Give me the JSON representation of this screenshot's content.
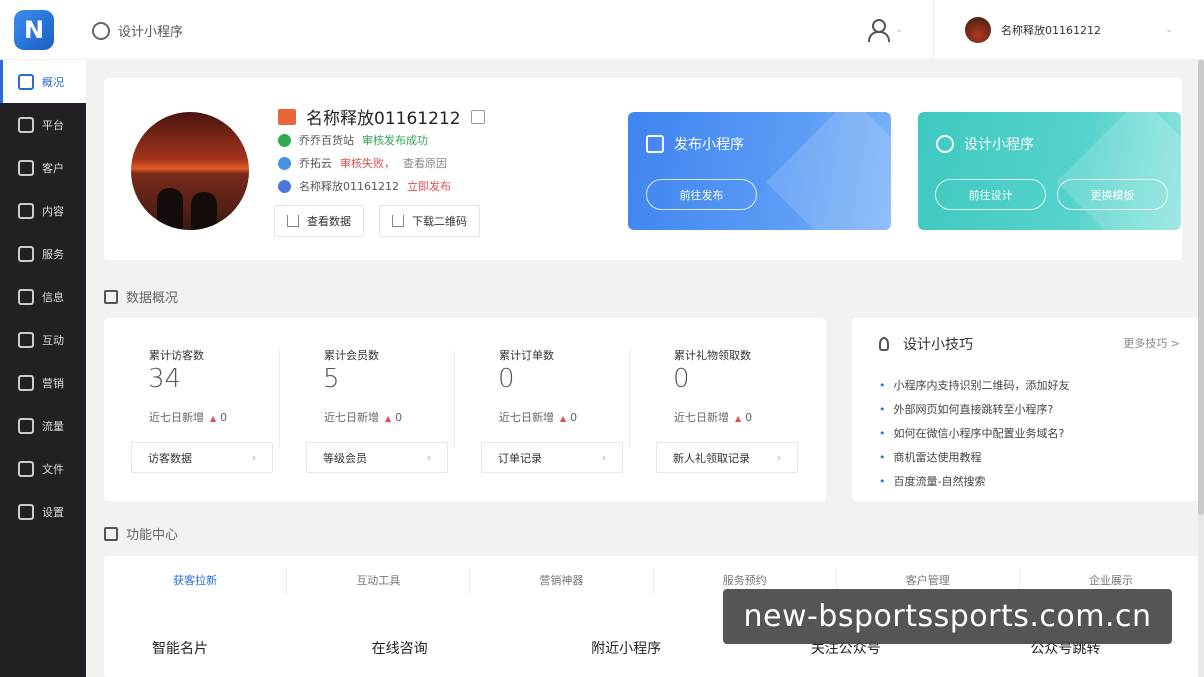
{
  "header": {
    "logo_letter": "N",
    "breadcrumb": "设计小程序",
    "account_name": "名称释放01161212"
  },
  "sidebar": {
    "items": [
      {
        "label": "概况",
        "icon": "chart-icon",
        "active": true
      },
      {
        "label": "平台",
        "icon": "layers-icon"
      },
      {
        "label": "客户",
        "icon": "user-icon"
      },
      {
        "label": "内容",
        "icon": "document-icon"
      },
      {
        "label": "服务",
        "icon": "service-icon"
      },
      {
        "label": "信息",
        "icon": "message-icon"
      },
      {
        "label": "互动",
        "icon": "interaction-icon"
      },
      {
        "label": "营销",
        "icon": "tag-icon"
      },
      {
        "label": "流量",
        "icon": "megaphone-icon"
      },
      {
        "label": "文件",
        "icon": "folder-icon"
      },
      {
        "label": "设置",
        "icon": "settings-icon"
      }
    ]
  },
  "profile": {
    "name": "名称释放01161212",
    "rows": [
      {
        "name": "乔乔百货站",
        "status": "审核发布成功",
        "status_type": "green",
        "dot": "#34a853"
      },
      {
        "name": "乔拓云",
        "status": "审核失败，",
        "status_type": "red",
        "extra": "查看原因",
        "dot": "#4a90e2"
      },
      {
        "name": "名称释放01161212",
        "status": "立即发布",
        "status_type": "red",
        "dot": "#4a78d8"
      }
    ],
    "btn_view_data": "查看数据",
    "btn_download_qr": "下载二维码"
  },
  "banners": {
    "publish": {
      "title": "发布小程序",
      "button": "前往发布"
    },
    "design": {
      "title": "设计小程序",
      "button_design": "前往设计",
      "button_template": "更换模板"
    }
  },
  "sections": {
    "data_overview": "数据概况",
    "function_center": "功能中心"
  },
  "stats": [
    {
      "label": "累计访客数",
      "value": "34",
      "recent": "近七日新增",
      "recent_value": "0",
      "button": "访客数据"
    },
    {
      "label": "累计会员数",
      "value": "5",
      "recent": "近七日新增",
      "recent_value": "0",
      "button": "等级会员"
    },
    {
      "label": "累计订单数",
      "value": "0",
      "recent": "近七日新增",
      "recent_value": "0",
      "button": "订单记录"
    },
    {
      "label": "累计礼物领取数",
      "value": "0",
      "recent": "近七日新增",
      "recent_value": "0",
      "button": "新人礼领取记录"
    }
  ],
  "tips": {
    "title": "设计小技巧",
    "more": "更多技巧 >",
    "items": [
      "小程序内支持识别二维码，添加好友",
      "外部网页如何直接跳转至小程序?",
      "如何在微信小程序中配置业务域名?",
      "商机雷达使用教程",
      "百度流量-自然搜索"
    ]
  },
  "function_tabs": [
    "获客拉新",
    "互动工具",
    "营销神器",
    "服务预约",
    "客户管理",
    "企业展示"
  ],
  "function_items": [
    "智能名片",
    "在线咨询",
    "附近小程序",
    "关注公众号",
    "公众号跳转"
  ],
  "watermark": "new-bsportssports.com.cn"
}
